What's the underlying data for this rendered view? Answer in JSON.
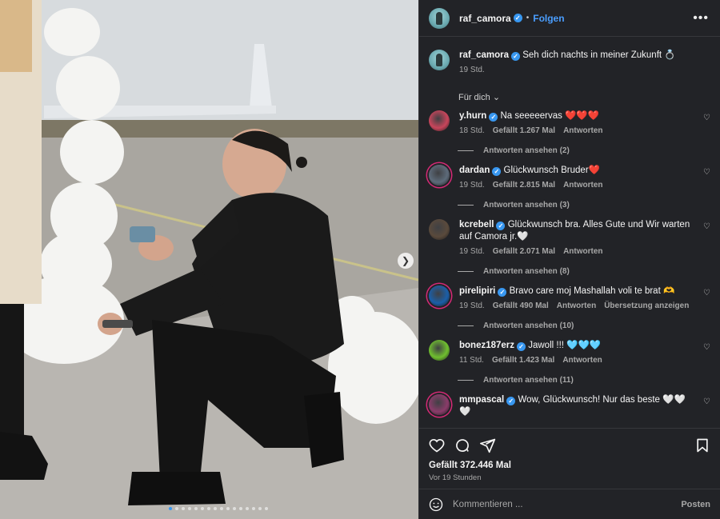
{
  "post": {
    "author": "raf_camora",
    "follow_label": "Folgen",
    "more_label": "•••"
  },
  "caption": {
    "user": "raf_camora",
    "text": "Seh dich nachts in meiner Zukunft 💍",
    "time": "19 Std."
  },
  "filter_label": "Für dich",
  "comments": [
    {
      "user": "y.hurn",
      "verified": true,
      "text": "Na seeeeervas ❤️❤️❤️",
      "time": "18 Std.",
      "likes": "Gefällt 1.267 Mal",
      "reply": "Antworten",
      "translate": "",
      "replies": "Antworten ansehen (2)",
      "avatar_color": "#c8455b",
      "ring": false
    },
    {
      "user": "dardan",
      "verified": true,
      "text": "Glückwunsch Bruder❤️",
      "time": "19 Std.",
      "likes": "Gefällt 2.815 Mal",
      "reply": "Antworten",
      "translate": "",
      "replies": "Antworten ansehen (3)",
      "avatar_color": "#5d6b7a",
      "ring": true
    },
    {
      "user": "kcrebell",
      "verified": true,
      "text": "Glückwunsch bra. Alles Gute und Wir warten auf Camora jr.🤍",
      "time": "19 Std.",
      "likes": "Gefällt 2.071 Mal",
      "reply": "Antworten",
      "translate": "",
      "replies": "Antworten ansehen (8)",
      "avatar_color": "#5a4a3c",
      "ring": false
    },
    {
      "user": "pirelipiri",
      "verified": true,
      "text": "Bravo care moj Mashallah voli te brat 🫶",
      "time": "19 Std.",
      "likes": "Gefällt 490 Mal",
      "reply": "Antworten",
      "translate": "Übersetzung anzeigen",
      "replies": "Antworten ansehen (10)",
      "avatar_color": "#1b5fa8",
      "ring": true
    },
    {
      "user": "bonez187erz",
      "verified": true,
      "text": "Jawoll !!! 🩵🩵🩵",
      "time": "11 Std.",
      "likes": "Gefällt 1.423 Mal",
      "reply": "Antworten",
      "translate": "",
      "replies": "Antworten ansehen (11)",
      "avatar_color": "#6fbf2f",
      "ring": false
    },
    {
      "user": "mmpascal",
      "verified": true,
      "text": "Wow, Glückwunsch! Nur das beste 🤍🤍🤍",
      "time": "",
      "likes": "",
      "reply": "",
      "translate": "",
      "replies": "",
      "avatar_color": "#8a3c6a",
      "ring": true
    }
  ],
  "actions": {
    "like_icon": "heart-icon",
    "comment_icon": "comment-icon",
    "share_icon": "share-icon",
    "save_icon": "bookmark-icon",
    "likes": "Gefällt 372.446 Mal",
    "ago": "Vor 19 Stunden"
  },
  "composer": {
    "placeholder": "Kommentieren ...",
    "post_label": "Posten"
  },
  "carousel": {
    "total": 16,
    "active": 0
  }
}
